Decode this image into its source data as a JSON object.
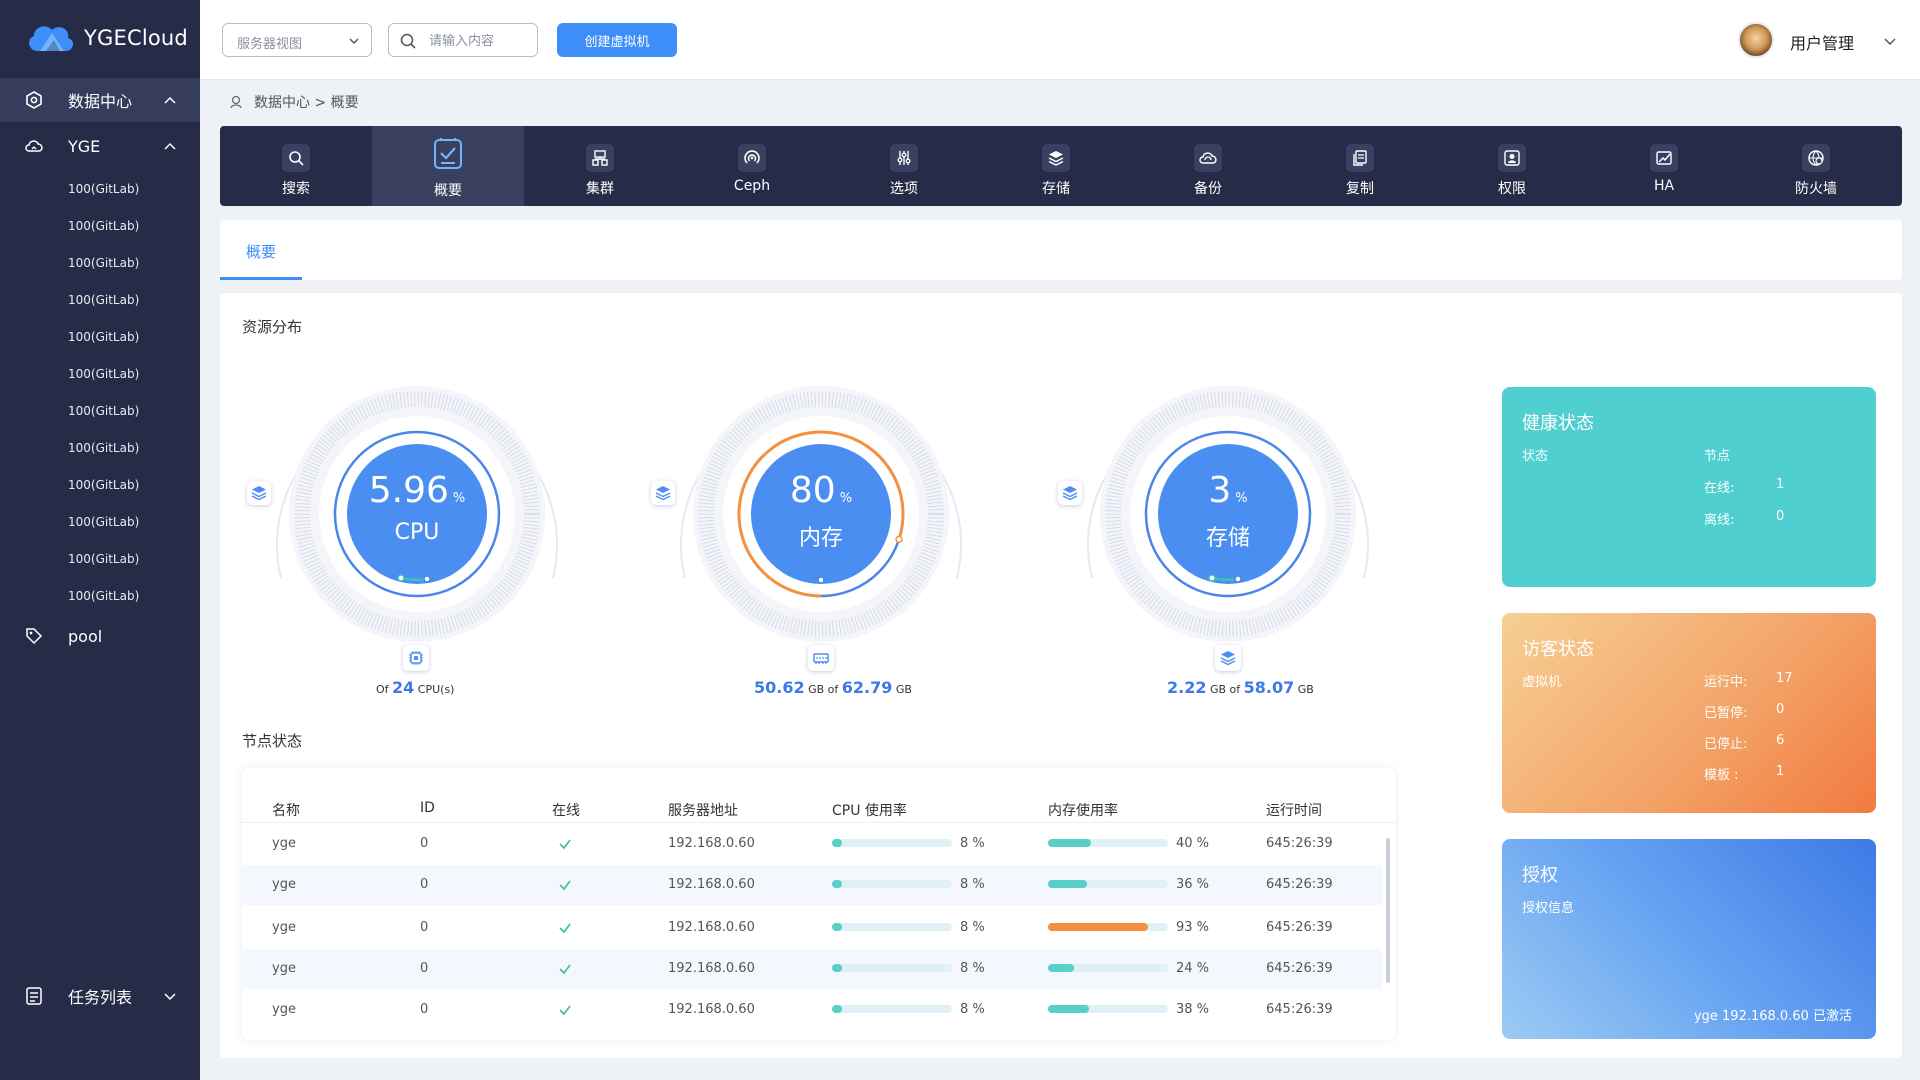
{
  "app": {
    "logo_text": "YGECloud"
  },
  "sidebar": {
    "datacenter_label": "数据中心",
    "yge_label": "YGE",
    "sub_items": [
      "100(GitLab)",
      "100(GitLab)",
      "100(GitLab)",
      "100(GitLab)",
      "100(GitLab)",
      "100(GitLab)",
      "100(GitLab)",
      "100(GitLab)",
      "100(GitLab)",
      "100(GitLab)",
      "100(GitLab)",
      "100(GitLab)"
    ],
    "pool_label": "pool",
    "tasks_label": "任务列表"
  },
  "header": {
    "view_select": "服务器视图",
    "search_placeholder": "请输入内容",
    "create_button": "创建虚拟机",
    "user_menu": "用户管理"
  },
  "breadcrumb": "数据中心 > 概要",
  "toolbar": {
    "items": [
      {
        "label": "搜索",
        "icon": "search-icon"
      },
      {
        "label": "概要",
        "icon": "summary-icon"
      },
      {
        "label": "集群",
        "icon": "cluster-icon"
      },
      {
        "label": "Ceph",
        "icon": "ceph-icon"
      },
      {
        "label": "选项",
        "icon": "options-icon"
      },
      {
        "label": "存储",
        "icon": "storage-icon"
      },
      {
        "label": "备份",
        "icon": "backup-icon"
      },
      {
        "label": "复制",
        "icon": "replicate-icon"
      },
      {
        "label": "权限",
        "icon": "permission-icon"
      },
      {
        "label": "HA",
        "icon": "ha-icon"
      },
      {
        "label": "防火墙",
        "icon": "firewall-icon"
      }
    ],
    "active": "概要"
  },
  "tab": {
    "label": "概要"
  },
  "resources": {
    "title": "资源分布",
    "cpu": {
      "value": "5.96",
      "unit": "%",
      "label": "CPU",
      "of_prefix": "Of",
      "count": "24",
      "count_unit": "CPU(s)"
    },
    "memory": {
      "value": "80",
      "unit": "%",
      "label": "内存",
      "used": "50.62",
      "used_unit": "GB of",
      "total": "62.79",
      "total_unit": "GB"
    },
    "storage": {
      "value": "3",
      "unit": "%",
      "label": "存储",
      "used": "2.22",
      "used_unit": "GB of",
      "total": "58.07",
      "total_unit": "GB"
    }
  },
  "nodes": {
    "title": "节点状态",
    "columns": [
      "名称",
      "ID",
      "在线",
      "服务器地址",
      "CPU 使用率",
      "内存使用率",
      "运行时间"
    ],
    "rows": [
      {
        "name": "yge",
        "id": "0",
        "addr": "192.168.0.60",
        "cpu": "8 %",
        "cpu_val": 8,
        "mem": "40 %",
        "mem_val": 40,
        "uptime": "645:26:39"
      },
      {
        "name": "yge",
        "id": "0",
        "addr": "192.168.0.60",
        "cpu": "8 %",
        "cpu_val": 8,
        "mem": "36 %",
        "mem_val": 36,
        "uptime": "645:26:39"
      },
      {
        "name": "yge",
        "id": "0",
        "addr": "192.168.0.60",
        "cpu": "8 %",
        "cpu_val": 8,
        "mem": "93 %",
        "mem_val": 93,
        "uptime": "645:26:39"
      },
      {
        "name": "yge",
        "id": "0",
        "addr": "192.168.0.60",
        "cpu": "8 %",
        "cpu_val": 8,
        "mem": "24 %",
        "mem_val": 24,
        "uptime": "645:26:39"
      },
      {
        "name": "yge",
        "id": "0",
        "addr": "192.168.0.60",
        "cpu": "8 %",
        "cpu_val": 8,
        "mem": "38 %",
        "mem_val": 38,
        "uptime": "645:26:39"
      }
    ]
  },
  "health": {
    "title": "健康状态",
    "status_label": "状态",
    "node_label": "节点",
    "online_label": "在线:",
    "online_value": "1",
    "offline_label": "离线:",
    "offline_value": "0"
  },
  "visitor": {
    "title": "访客状态",
    "vm_label": "虚拟机",
    "running_label": "运行中:",
    "running_value": "17",
    "paused_label": "已暂停:",
    "paused_value": "0",
    "stopped_label": "已停止:",
    "stopped_value": "6",
    "template_label": "模板 :",
    "template_value": "1"
  },
  "license": {
    "title": "授权",
    "info_label": "授权信息",
    "status": "yge 192.168.0.60 已激活"
  },
  "colors": {
    "sidebar_bg": "#262c48",
    "accent": "#3d8ef8",
    "teal": "#4fcfcf",
    "orange": "#f5913e",
    "bar_teal": "#58cfc7"
  }
}
